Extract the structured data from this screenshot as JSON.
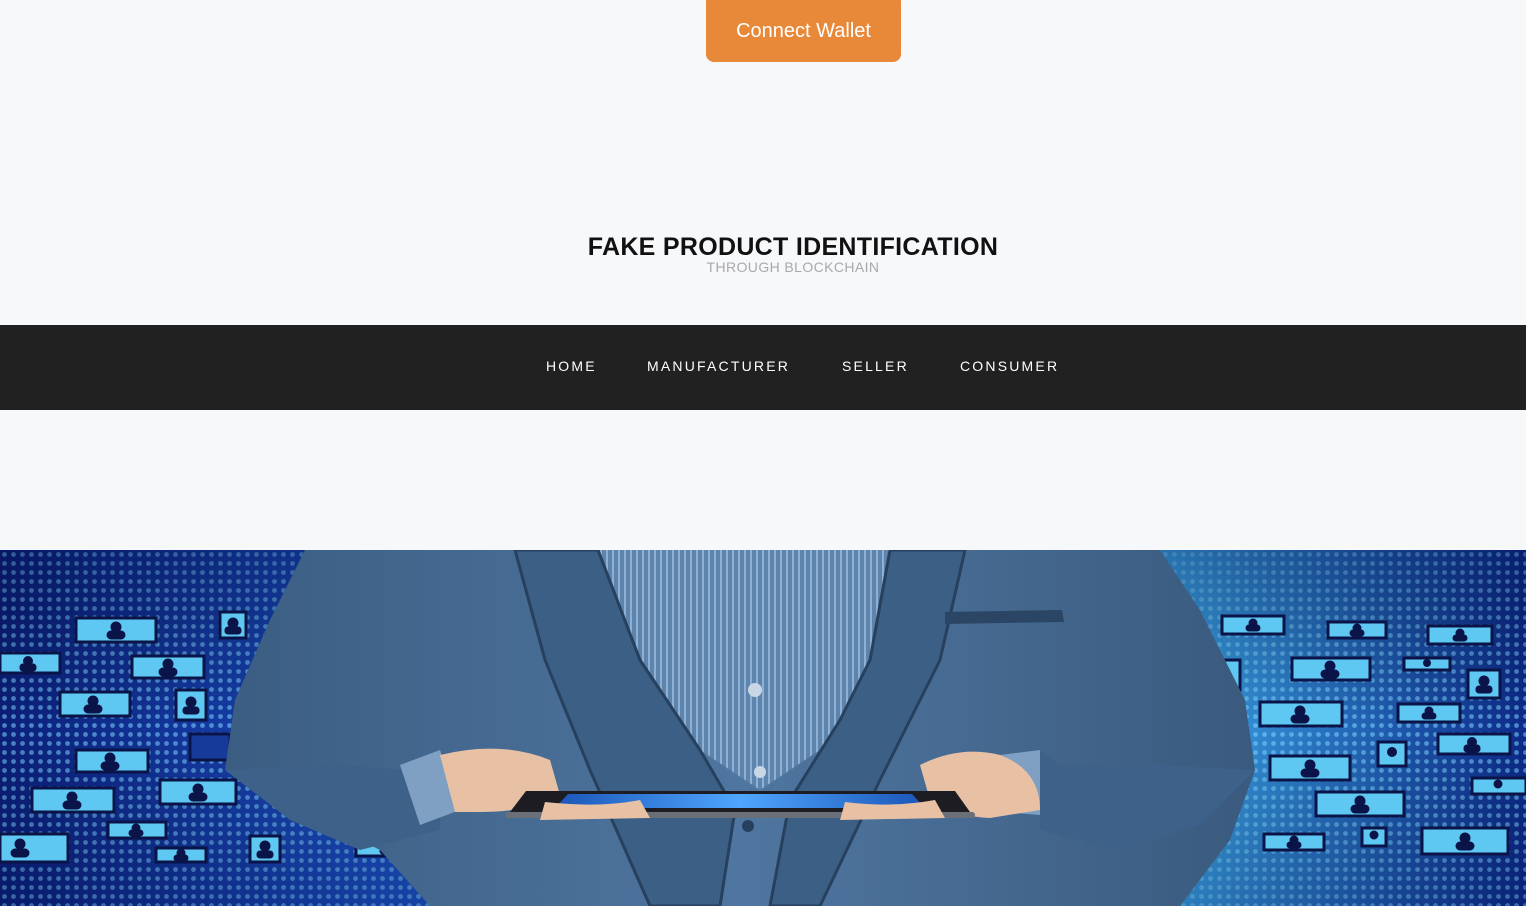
{
  "header": {
    "connect_wallet_label": "Connect Wallet"
  },
  "brand": {
    "title": "FAKE PRODUCT IDENTIFICATION",
    "subtitle": "THROUGH BLOCKCHAIN"
  },
  "nav": {
    "items": [
      {
        "label": "HOME"
      },
      {
        "label": "MANUFACTURER"
      },
      {
        "label": "SELLER"
      },
      {
        "label": "CONSUMER"
      }
    ]
  },
  "hero": {
    "image_icon": "businessman-tablet-network-illustration"
  },
  "colors": {
    "accent": "#e8893a",
    "nav_bg": "#212121",
    "page_bg": "#f7f8fa"
  }
}
